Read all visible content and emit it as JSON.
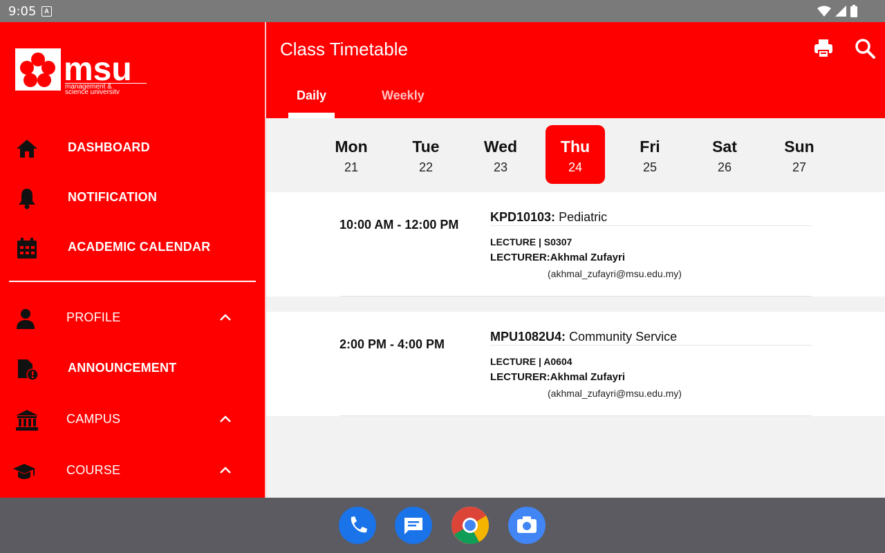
{
  "status_bar": {
    "time": "9:05",
    "notification_badge": "A"
  },
  "drawer": {
    "logo": {
      "text": "msu",
      "tagline_1": "management &",
      "tagline_2": "science university"
    },
    "items": [
      {
        "label": "DASHBOARD",
        "icon": "home-icon"
      },
      {
        "label": "NOTIFICATION",
        "icon": "bell-icon"
      },
      {
        "label": "ACADEMIC CALENDAR",
        "icon": "calendar-icon"
      },
      {
        "label": "PROFILE",
        "icon": "person-icon",
        "expand": "chevron-up-icon"
      },
      {
        "label": "ANNOUNCEMENT",
        "icon": "announcement-icon"
      },
      {
        "label": "CAMPUS",
        "icon": "institution-icon",
        "expand": "chevron-up-icon"
      },
      {
        "label": "COURSE",
        "icon": "graduation-cap-icon",
        "expand": "chevron-up-icon"
      }
    ]
  },
  "header": {
    "title": "Class Timetable",
    "tabs": [
      {
        "label": "Daily",
        "active": true
      },
      {
        "label": "Weekly",
        "active": false
      }
    ],
    "actions": [
      "print-icon",
      "search-icon"
    ]
  },
  "days": [
    {
      "name": "Mon",
      "date": "21"
    },
    {
      "name": "Tue",
      "date": "22"
    },
    {
      "name": "Wed",
      "date": "23"
    },
    {
      "name": "Thu",
      "date": "24",
      "selected": true
    },
    {
      "name": "Fri",
      "date": "25"
    },
    {
      "name": "Sat",
      "date": "26"
    },
    {
      "name": "Sun",
      "date": "27"
    }
  ],
  "classes": [
    {
      "time": "10:00 AM - 12:00 PM",
      "code": "KPD10103:",
      "name": "Pediatric",
      "type_room": "LECTURE  |  S0307",
      "lecturer_label": "LECTURER:",
      "lecturer": "Akhmal Zufayri",
      "email": "(akhmal_zufayri@msu.edu.my)"
    },
    {
      "time": "2:00 PM - 4:00 PM",
      "code": "MPU1082U4:",
      "name": "Community Service",
      "type_room": "LECTURE  |  A0604",
      "lecturer_label": "LECTURER:",
      "lecturer": "Akhmal Zufayri",
      "email": "(akhmal_zufayri@msu.edu.my)"
    }
  ],
  "dock": [
    "phone-icon",
    "messages-icon",
    "chrome-icon",
    "camera-icon"
  ],
  "colors": {
    "brand_red": "#ff0000",
    "status_bar": "#7a7a7a",
    "nav_bar": "#5b5b61"
  }
}
